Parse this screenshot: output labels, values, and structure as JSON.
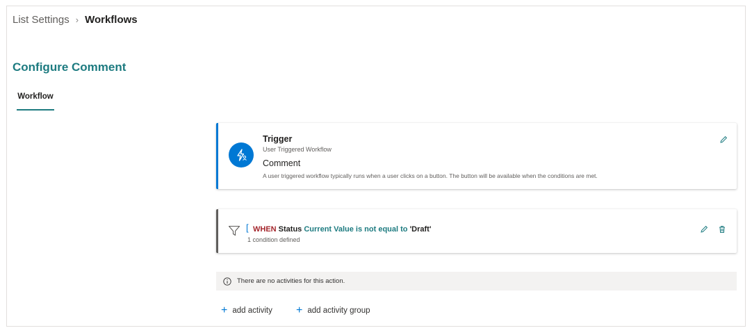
{
  "breadcrumb": {
    "parent": "List Settings",
    "separator": "›",
    "current": "Workflows"
  },
  "page": {
    "title": "Configure Comment"
  },
  "tabs": [
    {
      "label": "Workflow",
      "selected": true
    }
  ],
  "trigger": {
    "heading": "Trigger",
    "type": "User Triggered Workflow",
    "name": "Comment",
    "description": "A user triggered workflow typically runs when a user clicks on a button. The button will be available when the conditions are met.",
    "icon": "lightning-user-icon",
    "accent_color": "#0078d4"
  },
  "condition": {
    "bracket": "[",
    "when": "WHEN",
    "field": "Status",
    "operator": "Current Value is not equal to",
    "value": "'Draft'",
    "count_text": "1 condition defined",
    "accent_color": "#605e5c"
  },
  "info": {
    "text": "There are no activities for this action."
  },
  "actions": {
    "add_activity": "add activity",
    "add_activity_group": "add activity group",
    "plus": "+"
  },
  "colors": {
    "brand_teal": "#1d7b80",
    "primary_blue": "#0078d4",
    "when_red": "#a4262c"
  }
}
